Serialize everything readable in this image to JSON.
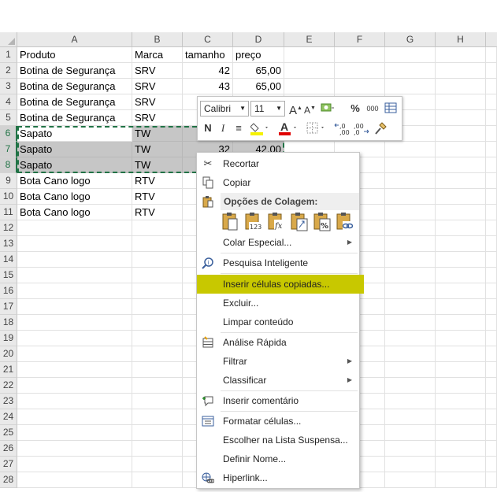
{
  "columns": [
    "A",
    "B",
    "C",
    "D",
    "E",
    "F",
    "G",
    "H"
  ],
  "rows": [
    "1",
    "2",
    "3",
    "4",
    "5",
    "6",
    "7",
    "8",
    "9",
    "10",
    "11",
    "12",
    "13",
    "14",
    "15",
    "16",
    "17",
    "18",
    "19",
    "20",
    "21",
    "22",
    "23",
    "24",
    "25",
    "26",
    "27",
    "28"
  ],
  "cells": [
    [
      "Produto",
      "Marca",
      "tamanho",
      "preço"
    ],
    [
      "Botina de Segurança",
      "SRV",
      "42",
      "65,00"
    ],
    [
      "Botina de Segurança",
      "SRV",
      "43",
      "65,00"
    ],
    [
      "Botina de Segurança",
      "SRV",
      "",
      ""
    ],
    [
      "Botina de Segurança",
      "SRV",
      "",
      ""
    ],
    [
      "Sapato",
      "TW",
      "",
      ""
    ],
    [
      "Sapato",
      "TW",
      "32",
      "42,00"
    ],
    [
      "Sapato",
      "TW",
      "",
      ""
    ],
    [
      "Bota Cano logo",
      "RTV",
      "",
      ""
    ],
    [
      "Bota Cano logo",
      "RTV",
      "",
      ""
    ],
    [
      "Bota Cano logo",
      "RTV",
      "",
      ""
    ]
  ],
  "minitoolbar": {
    "font_name": "Calibri",
    "font_size": "11",
    "percent": "%",
    "thousands": "000",
    "bold": "N",
    "italic": "I",
    "align": "≡",
    "font_color": "A",
    "dec_inc": "←,0 ,00",
    "dec_dec": ",00 →,0"
  },
  "context_menu": {
    "cut": "Recortar",
    "copy": "Copiar",
    "paste_options_title": "Opções de Colagem:",
    "paste_formulas": "fx",
    "paste_values": "123",
    "paste_percent": "%",
    "paste_special": "Colar Especial...",
    "smart_lookup": "Pesquisa Inteligente",
    "insert_copied": "Inserir células copiadas...",
    "delete": "Excluir...",
    "clear": "Limpar conteúdo",
    "quick_analysis": "Análise Rápida",
    "filter": "Filtrar",
    "sort": "Classificar",
    "insert_comment": "Inserir comentário",
    "format_cells": "Formatar células...",
    "pick_list": "Escolher na Lista Suspensa...",
    "define_name": "Definir Nome...",
    "hyperlink": "Hiperlink..."
  },
  "colors": {
    "selection_green": "#217346",
    "menu_highlight": "#c8c800",
    "selected_fill": "#c6c6c6"
  }
}
